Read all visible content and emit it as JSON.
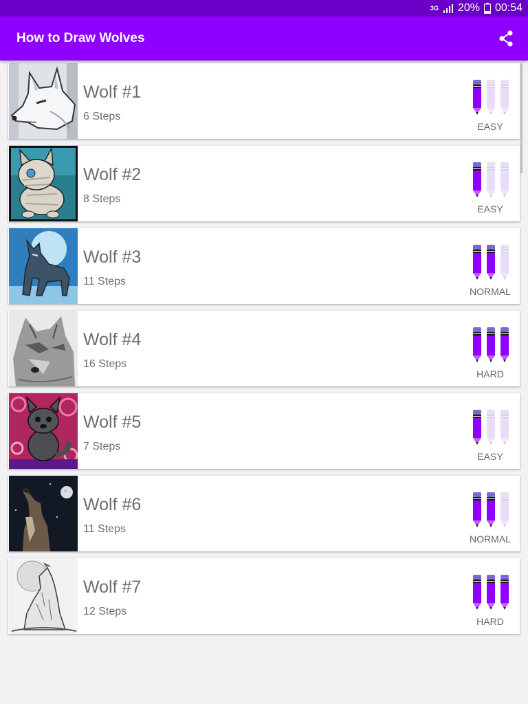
{
  "status_bar": {
    "network": "3G",
    "battery": "20%",
    "time": "00:54"
  },
  "app_bar": {
    "title": "How to Draw Wolves",
    "share_icon": "share-icon"
  },
  "colors": {
    "status_bar": "#6a00c8",
    "app_bar": "#8f00ff",
    "pencil_active": "#8f00ff",
    "pencil_inactive": "#eadcfb"
  },
  "items": [
    {
      "title": "Wolf #1",
      "steps": "6 Steps",
      "difficulty": "EASY",
      "level": 1,
      "thumbnail": "white-wolf-head"
    },
    {
      "title": "Wolf #2",
      "steps": "8 Steps",
      "difficulty": "EASY",
      "level": 1,
      "thumbnail": "bandaged-wolf-pup"
    },
    {
      "title": "Wolf #3",
      "steps": "11 Steps",
      "difficulty": "NORMAL",
      "level": 2,
      "thumbnail": "wolf-under-moon"
    },
    {
      "title": "Wolf #4",
      "steps": "16 Steps",
      "difficulty": "HARD",
      "level": 3,
      "thumbnail": "realistic-wolf-portrait"
    },
    {
      "title": "Wolf #5",
      "steps": "7 Steps",
      "difficulty": "EASY",
      "level": 1,
      "thumbnail": "cartoon-wolf-pup"
    },
    {
      "title": "Wolf #6",
      "steps": "11 Steps",
      "difficulty": "NORMAL",
      "level": 2,
      "thumbnail": "howling-wolf-night"
    },
    {
      "title": "Wolf #7",
      "steps": "12 Steps",
      "difficulty": "HARD",
      "level": 3,
      "thumbnail": "howling-wolf-sketch"
    }
  ]
}
